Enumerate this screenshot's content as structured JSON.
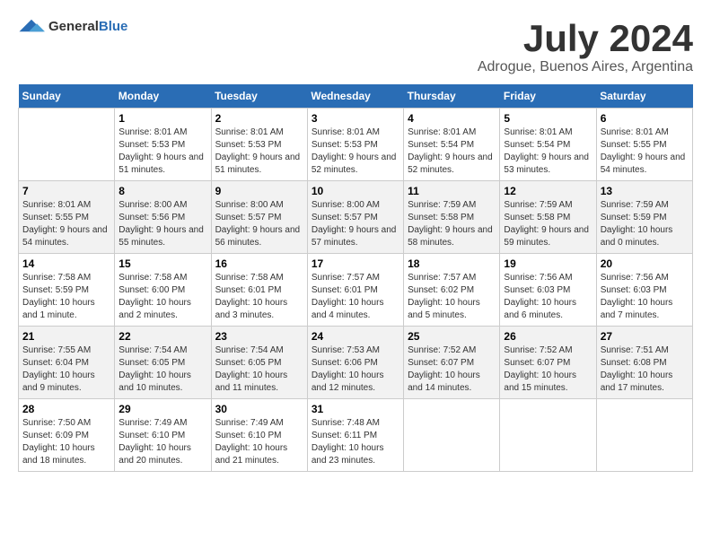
{
  "logo": {
    "general": "General",
    "blue": "Blue"
  },
  "title": "July 2024",
  "subtitle": "Adrogue, Buenos Aires, Argentina",
  "headers": [
    "Sunday",
    "Monday",
    "Tuesday",
    "Wednesday",
    "Thursday",
    "Friday",
    "Saturday"
  ],
  "weeks": [
    [
      {
        "day": "",
        "sunrise": "",
        "sunset": "",
        "daylight": ""
      },
      {
        "day": "1",
        "sunrise": "Sunrise: 8:01 AM",
        "sunset": "Sunset: 5:53 PM",
        "daylight": "Daylight: 9 hours and 51 minutes."
      },
      {
        "day": "2",
        "sunrise": "Sunrise: 8:01 AM",
        "sunset": "Sunset: 5:53 PM",
        "daylight": "Daylight: 9 hours and 51 minutes."
      },
      {
        "day": "3",
        "sunrise": "Sunrise: 8:01 AM",
        "sunset": "Sunset: 5:53 PM",
        "daylight": "Daylight: 9 hours and 52 minutes."
      },
      {
        "day": "4",
        "sunrise": "Sunrise: 8:01 AM",
        "sunset": "Sunset: 5:54 PM",
        "daylight": "Daylight: 9 hours and 52 minutes."
      },
      {
        "day": "5",
        "sunrise": "Sunrise: 8:01 AM",
        "sunset": "Sunset: 5:54 PM",
        "daylight": "Daylight: 9 hours and 53 minutes."
      },
      {
        "day": "6",
        "sunrise": "Sunrise: 8:01 AM",
        "sunset": "Sunset: 5:55 PM",
        "daylight": "Daylight: 9 hours and 54 minutes."
      }
    ],
    [
      {
        "day": "7",
        "sunrise": "Sunrise: 8:01 AM",
        "sunset": "Sunset: 5:55 PM",
        "daylight": "Daylight: 9 hours and 54 minutes."
      },
      {
        "day": "8",
        "sunrise": "Sunrise: 8:00 AM",
        "sunset": "Sunset: 5:56 PM",
        "daylight": "Daylight: 9 hours and 55 minutes."
      },
      {
        "day": "9",
        "sunrise": "Sunrise: 8:00 AM",
        "sunset": "Sunset: 5:57 PM",
        "daylight": "Daylight: 9 hours and 56 minutes."
      },
      {
        "day": "10",
        "sunrise": "Sunrise: 8:00 AM",
        "sunset": "Sunset: 5:57 PM",
        "daylight": "Daylight: 9 hours and 57 minutes."
      },
      {
        "day": "11",
        "sunrise": "Sunrise: 7:59 AM",
        "sunset": "Sunset: 5:58 PM",
        "daylight": "Daylight: 9 hours and 58 minutes."
      },
      {
        "day": "12",
        "sunrise": "Sunrise: 7:59 AM",
        "sunset": "Sunset: 5:58 PM",
        "daylight": "Daylight: 9 hours and 59 minutes."
      },
      {
        "day": "13",
        "sunrise": "Sunrise: 7:59 AM",
        "sunset": "Sunset: 5:59 PM",
        "daylight": "Daylight: 10 hours and 0 minutes."
      }
    ],
    [
      {
        "day": "14",
        "sunrise": "Sunrise: 7:58 AM",
        "sunset": "Sunset: 5:59 PM",
        "daylight": "Daylight: 10 hours and 1 minute."
      },
      {
        "day": "15",
        "sunrise": "Sunrise: 7:58 AM",
        "sunset": "Sunset: 6:00 PM",
        "daylight": "Daylight: 10 hours and 2 minutes."
      },
      {
        "day": "16",
        "sunrise": "Sunrise: 7:58 AM",
        "sunset": "Sunset: 6:01 PM",
        "daylight": "Daylight: 10 hours and 3 minutes."
      },
      {
        "day": "17",
        "sunrise": "Sunrise: 7:57 AM",
        "sunset": "Sunset: 6:01 PM",
        "daylight": "Daylight: 10 hours and 4 minutes."
      },
      {
        "day": "18",
        "sunrise": "Sunrise: 7:57 AM",
        "sunset": "Sunset: 6:02 PM",
        "daylight": "Daylight: 10 hours and 5 minutes."
      },
      {
        "day": "19",
        "sunrise": "Sunrise: 7:56 AM",
        "sunset": "Sunset: 6:03 PM",
        "daylight": "Daylight: 10 hours and 6 minutes."
      },
      {
        "day": "20",
        "sunrise": "Sunrise: 7:56 AM",
        "sunset": "Sunset: 6:03 PM",
        "daylight": "Daylight: 10 hours and 7 minutes."
      }
    ],
    [
      {
        "day": "21",
        "sunrise": "Sunrise: 7:55 AM",
        "sunset": "Sunset: 6:04 PM",
        "daylight": "Daylight: 10 hours and 9 minutes."
      },
      {
        "day": "22",
        "sunrise": "Sunrise: 7:54 AM",
        "sunset": "Sunset: 6:05 PM",
        "daylight": "Daylight: 10 hours and 10 minutes."
      },
      {
        "day": "23",
        "sunrise": "Sunrise: 7:54 AM",
        "sunset": "Sunset: 6:05 PM",
        "daylight": "Daylight: 10 hours and 11 minutes."
      },
      {
        "day": "24",
        "sunrise": "Sunrise: 7:53 AM",
        "sunset": "Sunset: 6:06 PM",
        "daylight": "Daylight: 10 hours and 12 minutes."
      },
      {
        "day": "25",
        "sunrise": "Sunrise: 7:52 AM",
        "sunset": "Sunset: 6:07 PM",
        "daylight": "Daylight: 10 hours and 14 minutes."
      },
      {
        "day": "26",
        "sunrise": "Sunrise: 7:52 AM",
        "sunset": "Sunset: 6:07 PM",
        "daylight": "Daylight: 10 hours and 15 minutes."
      },
      {
        "day": "27",
        "sunrise": "Sunrise: 7:51 AM",
        "sunset": "Sunset: 6:08 PM",
        "daylight": "Daylight: 10 hours and 17 minutes."
      }
    ],
    [
      {
        "day": "28",
        "sunrise": "Sunrise: 7:50 AM",
        "sunset": "Sunset: 6:09 PM",
        "daylight": "Daylight: 10 hours and 18 minutes."
      },
      {
        "day": "29",
        "sunrise": "Sunrise: 7:49 AM",
        "sunset": "Sunset: 6:10 PM",
        "daylight": "Daylight: 10 hours and 20 minutes."
      },
      {
        "day": "30",
        "sunrise": "Sunrise: 7:49 AM",
        "sunset": "Sunset: 6:10 PM",
        "daylight": "Daylight: 10 hours and 21 minutes."
      },
      {
        "day": "31",
        "sunrise": "Sunrise: 7:48 AM",
        "sunset": "Sunset: 6:11 PM",
        "daylight": "Daylight: 10 hours and 23 minutes."
      },
      {
        "day": "",
        "sunrise": "",
        "sunset": "",
        "daylight": ""
      },
      {
        "day": "",
        "sunrise": "",
        "sunset": "",
        "daylight": ""
      },
      {
        "day": "",
        "sunrise": "",
        "sunset": "",
        "daylight": ""
      }
    ]
  ]
}
